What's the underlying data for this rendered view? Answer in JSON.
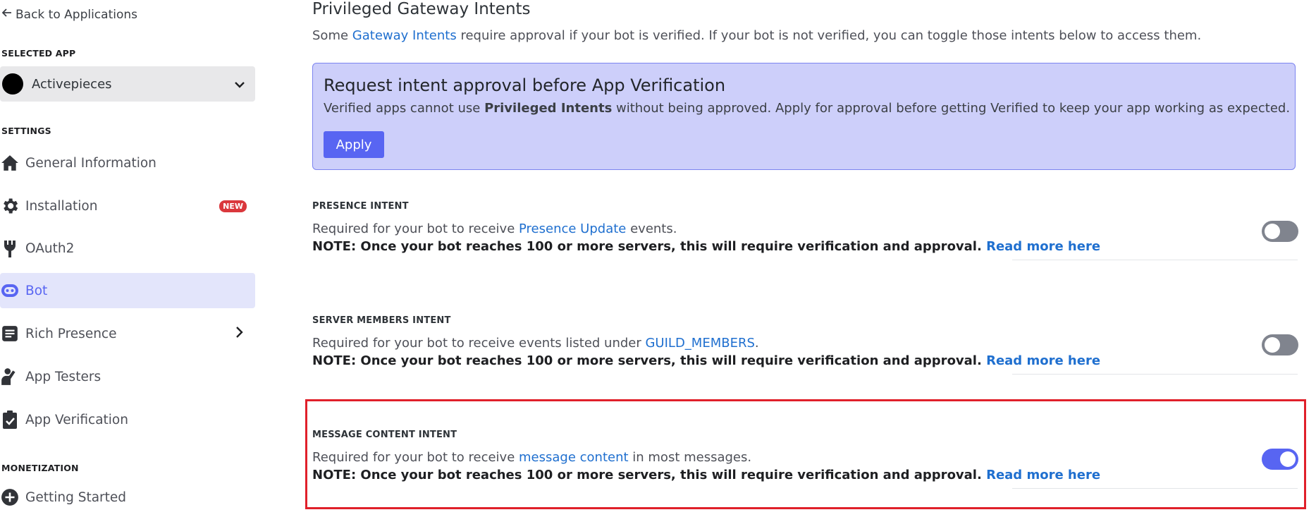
{
  "sidebar": {
    "back_label": "Back to Applications",
    "selected_app_header": "SELECTED APP",
    "app_name": "Activepieces",
    "settings_header": "SETTINGS",
    "items": [
      {
        "label": "General Information",
        "icon": "home-icon"
      },
      {
        "label": "Installation",
        "icon": "gear-icon",
        "badge": "NEW"
      },
      {
        "label": "OAuth2",
        "icon": "wrench-icon"
      },
      {
        "label": "Bot",
        "icon": "bot-icon",
        "active": true
      },
      {
        "label": "Rich Presence",
        "icon": "document-icon"
      },
      {
        "label": "App Testers",
        "icon": "person-wave-icon"
      },
      {
        "label": "App Verification",
        "icon": "clipboard-check-icon"
      }
    ],
    "monetization_header": "MONETIZATION",
    "monetization_items": [
      {
        "label": "Getting Started",
        "icon": "plus-circle-icon"
      }
    ]
  },
  "main": {
    "title": "Privileged Gateway Intents",
    "subtitle_pre": "Some ",
    "subtitle_link": "Gateway Intents",
    "subtitle_post": " require approval if your bot is verified. If your bot is not verified, you can toggle those intents below to access them.",
    "callout": {
      "title": "Request intent approval before App Verification",
      "text_pre": "Verified apps cannot use ",
      "text_bold": "Privileged Intents",
      "text_post": " without being approved. Apply for approval before getting Verified to keep your app working as expected.",
      "button": "Apply"
    },
    "intents": [
      {
        "title": "PRESENCE INTENT",
        "desc_pre": "Required for your bot to receive ",
        "desc_link": "Presence Update",
        "desc_post": " events.",
        "note": "NOTE: Once your bot reaches 100 or more servers, this will require verification and approval. ",
        "note_link": "Read more here",
        "enabled": false
      },
      {
        "title": "SERVER MEMBERS INTENT",
        "desc_pre": "Required for your bot to receive events listed under ",
        "desc_link": "GUILD_MEMBERS",
        "desc_post": ".",
        "note": "NOTE: Once your bot reaches 100 or more servers, this will require verification and approval. ",
        "note_link": "Read more here",
        "enabled": false
      },
      {
        "title": "MESSAGE CONTENT INTENT",
        "desc_pre": "Required for your bot to receive ",
        "desc_link": "message content",
        "desc_post": " in most messages.",
        "note": "NOTE: Once your bot reaches 100 or more servers, this will require verification and approval. ",
        "note_link": "Read more here",
        "enabled": true
      }
    ]
  },
  "colors": {
    "accent": "#5865f2",
    "link": "#1f6fcf",
    "callout_bg": "#cdcffa",
    "highlight": "#e0202a"
  }
}
